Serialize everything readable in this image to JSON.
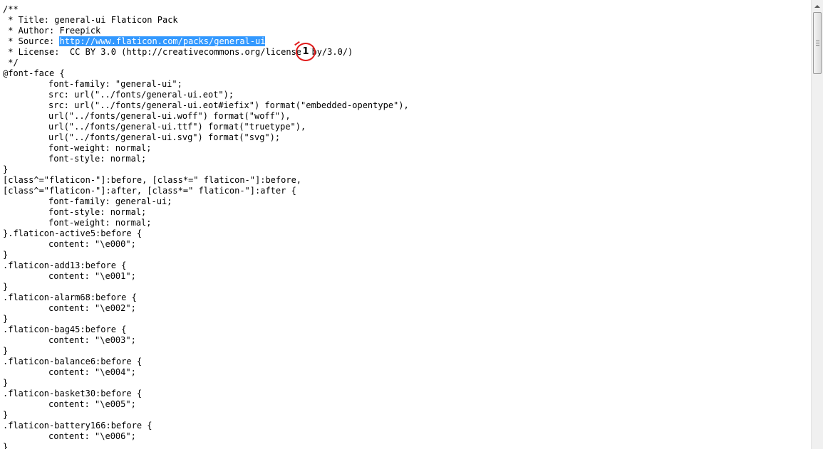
{
  "document": {
    "lines": [
      {
        "indent": false,
        "text": "/**"
      },
      {
        "indent": false,
        "text": " * Title: general-ui Flaticon Pack"
      },
      {
        "indent": false,
        "text": " * Author: Freepick"
      },
      {
        "indent": false,
        "text": " * Source: ",
        "selected": "http://www.flaticon.com/packs/general-ui"
      },
      {
        "indent": false,
        "text": " * License:  CC BY 3.0 (http://creativecommons.org/licenses/by/3.0/)"
      },
      {
        "indent": false,
        "text": " */"
      },
      {
        "indent": false,
        "text": "@font-face {"
      },
      {
        "indent": true,
        "text": "font-family: \"general-ui\";"
      },
      {
        "indent": true,
        "text": "src: url(\"../fonts/general-ui.eot\");"
      },
      {
        "indent": true,
        "text": "src: url(\"../fonts/general-ui.eot#iefix\") format(\"embedded-opentype\"),"
      },
      {
        "indent": true,
        "text": "url(\"../fonts/general-ui.woff\") format(\"woff\"),"
      },
      {
        "indent": true,
        "text": "url(\"../fonts/general-ui.ttf\") format(\"truetype\"),"
      },
      {
        "indent": true,
        "text": "url(\"../fonts/general-ui.svg\") format(\"svg\");"
      },
      {
        "indent": true,
        "text": "font-weight: normal;"
      },
      {
        "indent": true,
        "text": "font-style: normal;"
      },
      {
        "indent": false,
        "text": "}"
      },
      {
        "indent": false,
        "text": "[class^=\"flaticon-\"]:before, [class*=\" flaticon-\"]:before,"
      },
      {
        "indent": false,
        "text": "[class^=\"flaticon-\"]:after, [class*=\" flaticon-\"]:after {"
      },
      {
        "indent": true,
        "text": "font-family: general-ui;"
      },
      {
        "indent": true,
        "text": "font-style: normal;"
      },
      {
        "indent": true,
        "text": "font-weight: normal;"
      },
      {
        "indent": false,
        "text": "}.flaticon-active5:before {"
      },
      {
        "indent": true,
        "text": "content: \"\\e000\";"
      },
      {
        "indent": false,
        "text": "}"
      },
      {
        "indent": false,
        "text": ".flaticon-add13:before {"
      },
      {
        "indent": true,
        "text": "content: \"\\e001\";"
      },
      {
        "indent": false,
        "text": "}"
      },
      {
        "indent": false,
        "text": ".flaticon-alarm68:before {"
      },
      {
        "indent": true,
        "text": "content: \"\\e002\";"
      },
      {
        "indent": false,
        "text": "}"
      },
      {
        "indent": false,
        "text": ".flaticon-bag45:before {"
      },
      {
        "indent": true,
        "text": "content: \"\\e003\";"
      },
      {
        "indent": false,
        "text": "}"
      },
      {
        "indent": false,
        "text": ".flaticon-balance6:before {"
      },
      {
        "indent": true,
        "text": "content: \"\\e004\";"
      },
      {
        "indent": false,
        "text": "}"
      },
      {
        "indent": false,
        "text": ".flaticon-basket30:before {"
      },
      {
        "indent": true,
        "text": "content: \"\\e005\";"
      },
      {
        "indent": false,
        "text": "}"
      },
      {
        "indent": false,
        "text": ".flaticon-battery166:before {"
      },
      {
        "indent": true,
        "text": "content: \"\\e006\";"
      },
      {
        "indent": false,
        "text": "}"
      }
    ]
  },
  "annotation": {
    "marker_label": "1",
    "marker_color": "#e01b1b"
  },
  "selection_color": "#3399ff"
}
